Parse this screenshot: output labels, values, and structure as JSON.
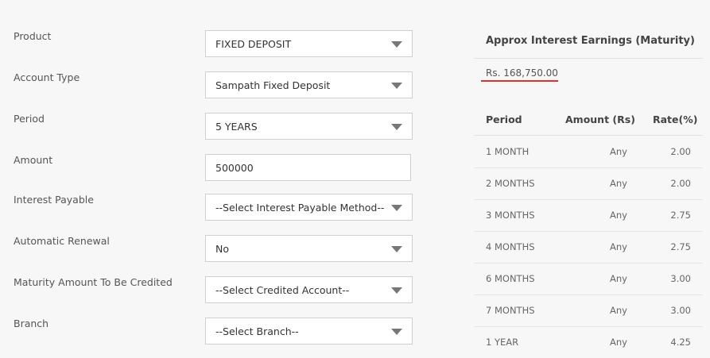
{
  "form": {
    "fields": [
      {
        "label": "Product",
        "value": "FIXED DEPOSIT",
        "kind": "select"
      },
      {
        "label": "Account Type",
        "value": "Sampath Fixed Deposit",
        "kind": "select"
      },
      {
        "label": "Period",
        "value": "5 YEARS",
        "kind": "select"
      },
      {
        "label": "Amount",
        "value": "500000",
        "kind": "input"
      },
      {
        "label": "Interest Payable",
        "value": "--Select Interest Payable Method--",
        "kind": "select"
      },
      {
        "label": "Automatic Renewal",
        "value": "No",
        "kind": "select"
      },
      {
        "label": "Maturity Amount To Be Credited",
        "value": "--Select Credited Account--",
        "kind": "select"
      },
      {
        "label": "Branch",
        "value": "--Select Branch--",
        "kind": "select"
      }
    ]
  },
  "summary": {
    "title": "Approx Interest Earnings (Maturity)",
    "amount": "Rs. 168,750.00",
    "accent_color": "#e03030"
  },
  "rates_table": {
    "headers": [
      "Period",
      "Amount (Rs)",
      "Rate(%)"
    ],
    "rows": [
      {
        "period": "1 MONTH",
        "amount": "Any",
        "rate": "2.00"
      },
      {
        "period": "2 MONTHS",
        "amount": "Any",
        "rate": "2.00"
      },
      {
        "period": "3 MONTHS",
        "amount": "Any",
        "rate": "2.75"
      },
      {
        "period": "4 MONTHS",
        "amount": "Any",
        "rate": "2.75"
      },
      {
        "period": "6 MONTHS",
        "amount": "Any",
        "rate": "3.00"
      },
      {
        "period": "7 MONTHS",
        "amount": "Any",
        "rate": "3.00"
      },
      {
        "period": "1 YEAR",
        "amount": "Any",
        "rate": "4.25"
      }
    ]
  }
}
